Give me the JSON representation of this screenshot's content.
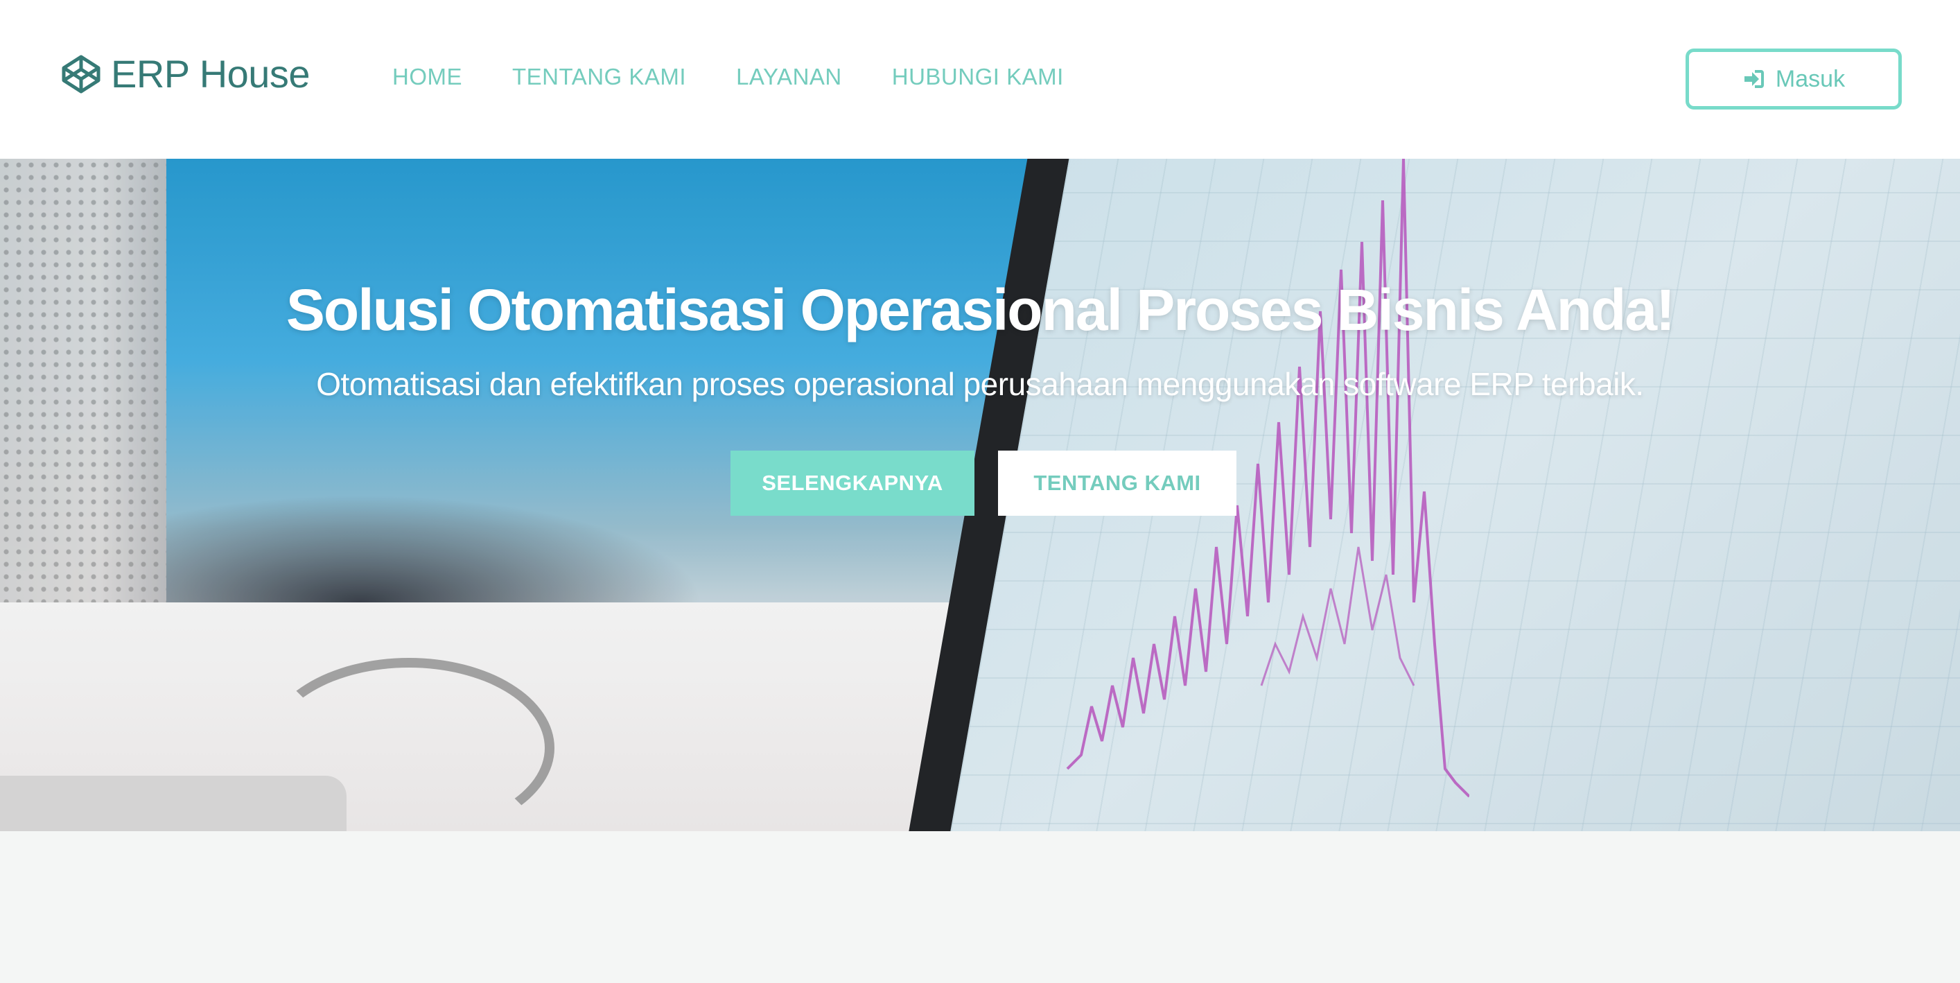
{
  "brand": {
    "name": "ERP House",
    "icon": "codepen-cube-icon",
    "color": "#367a76"
  },
  "nav": {
    "items": [
      {
        "label": "HOME"
      },
      {
        "label": "TENTANG KAMI"
      },
      {
        "label": "LAYANAN"
      },
      {
        "label": "HUBUNGI KAMI"
      }
    ],
    "color": "#74ccbd"
  },
  "login": {
    "label": "Masuk",
    "icon": "sign-in-icon",
    "accent": "#78dbca"
  },
  "hero": {
    "title": "Solusi Otomatisasi Operasional Proses Bisnis Anda!",
    "subtitle": "Otomatisasi dan efektifkan proses operasional perusahaan menggunakan software ERP terbaik.",
    "primary_button": "SELENGKAPNYA",
    "secondary_button": "TENTANG KAMI",
    "accent": "#79dccb"
  }
}
